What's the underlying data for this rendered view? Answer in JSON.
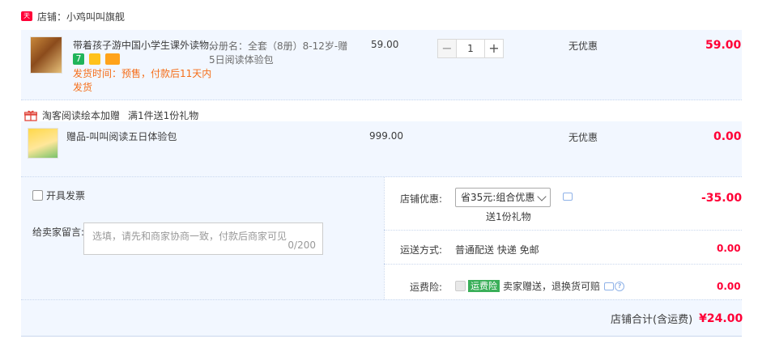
{
  "shop": {
    "badge": "天猫",
    "label": "店铺：小鸡叫叫旗舰"
  },
  "item": {
    "title_line1": "带着孩子游中国小学生课外读物...",
    "sku_line1": "分册名：全套（8册）8-12岁-赠",
    "sku_line2": "5日阅读体验包",
    "price": "59.00",
    "qty": "1",
    "qty_minus": "−",
    "qty_plus": "+",
    "discount": "无优惠",
    "subtotal": "59.00",
    "ship_line1": "发货时间：预售，付款后11天内",
    "ship_line2": "发货",
    "badges": [
      "7",
      "",
      ""
    ]
  },
  "promo": {
    "title": "淘客阅读绘本加赠",
    "rule": "满1件送1份礼物"
  },
  "gift": {
    "title": "赠品-叫叫阅读五日体验包",
    "price": "999.00",
    "discount": "无优惠",
    "subtotal": "0.00"
  },
  "invoice": {
    "label": "开具发票"
  },
  "message": {
    "label": "给卖家留言:",
    "placeholder": "选填，请先和商家协商一致，付款后商家可见",
    "counter": "0/200"
  },
  "shop_discount": {
    "label": "店铺优惠:",
    "selected": "省35元:组合优惠",
    "note": "送1份礼物",
    "amount": "-35.00"
  },
  "shipping": {
    "label": "运送方式:",
    "value": "普通配送 快递 免邮",
    "amount": "0.00"
  },
  "insurance": {
    "label": "运费险:",
    "badge": "运费险",
    "text": "卖家赠送，退换货可赔",
    "amount": "0.00"
  },
  "total": {
    "label": "店铺合计(含运费)",
    "value": "¥24.00"
  },
  "colors": {
    "price_red": "#ff0036",
    "orange": "#f56e19",
    "panel_bg": "#f2f7ff"
  }
}
